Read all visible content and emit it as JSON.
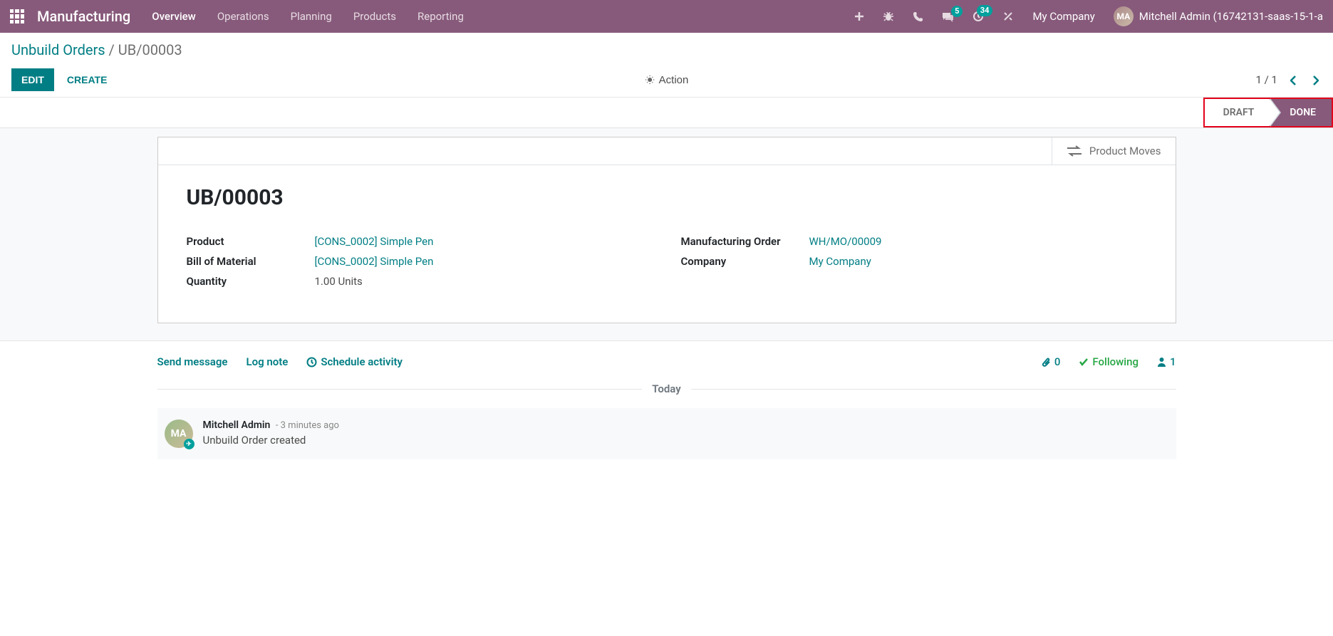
{
  "navbar": {
    "brand": "Manufacturing",
    "menu": [
      "Overview",
      "Operations",
      "Planning",
      "Products",
      "Reporting"
    ],
    "badges": {
      "messages": "5",
      "activities": "34"
    },
    "company": "My Company",
    "user": "Mitchell Admin (16742131-saas-15-1-a"
  },
  "breadcrumb": {
    "root": "Unbuild Orders",
    "current": "UB/00003"
  },
  "toolbar": {
    "edit": "EDIT",
    "create": "CREATE",
    "action": "Action",
    "pager": "1 / 1"
  },
  "status": {
    "draft": "DRAFT",
    "done": "DONE"
  },
  "statbtn": {
    "product_moves": "Product Moves"
  },
  "record": {
    "name": "UB/00003",
    "labels": {
      "product": "Product",
      "bom": "Bill of Material",
      "qty": "Quantity",
      "mo": "Manufacturing Order",
      "company": "Company"
    },
    "product": "[CONS_0002] Simple Pen",
    "bom": "[CONS_0002] Simple Pen",
    "qty": "1.00",
    "uom": "Units",
    "mo": "WH/MO/00009",
    "company": "My Company"
  },
  "chatter": {
    "send": "Send message",
    "log": "Log note",
    "schedule": "Schedule activity",
    "attachments": "0",
    "following": "Following",
    "followers": "1",
    "today": "Today",
    "msg": {
      "author": "Mitchell Admin",
      "time": "- 3 minutes ago",
      "text": "Unbuild Order created"
    }
  }
}
